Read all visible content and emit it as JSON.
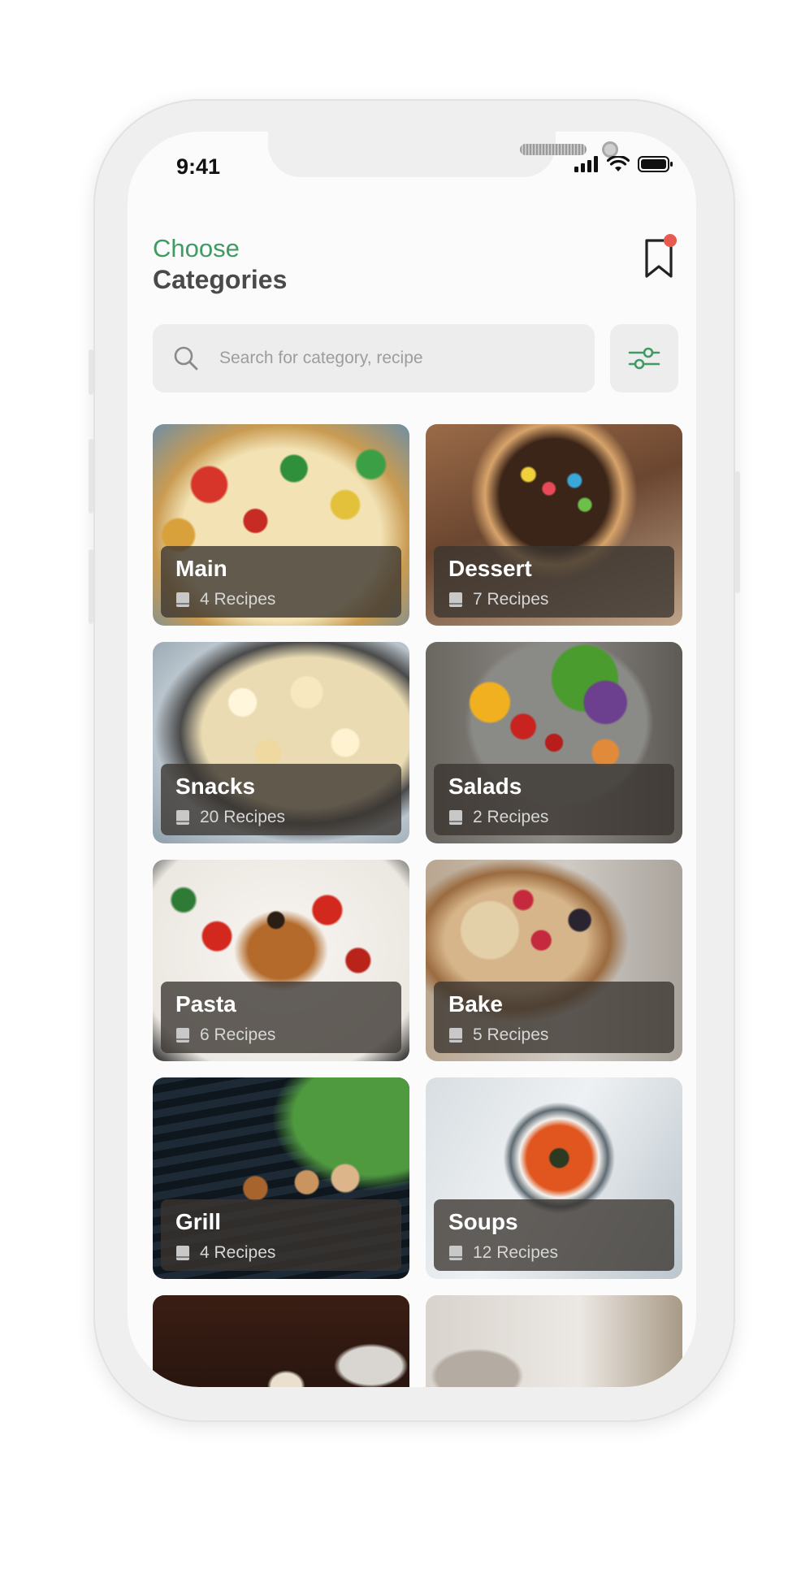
{
  "status_bar": {
    "time": "9:41"
  },
  "header": {
    "subtitle": "Choose",
    "title": "Categories"
  },
  "search": {
    "placeholder": "Search for category, recipe"
  },
  "categories": [
    {
      "name": "Main",
      "count": "4 Recipes"
    },
    {
      "name": "Dessert",
      "count": "7 Recipes"
    },
    {
      "name": "Snacks",
      "count": "20 Recipes"
    },
    {
      "name": "Salads",
      "count": "2 Recipes"
    },
    {
      "name": "Pasta",
      "count": "6 Recipes"
    },
    {
      "name": "Bake",
      "count": "5 Recipes"
    },
    {
      "name": "Grill",
      "count": "4 Recipes"
    },
    {
      "name": "Soups",
      "count": "12 Recipes"
    }
  ],
  "colors": {
    "accent": "#3f9a63",
    "notification": "#e8594e",
    "title": "#4a4a4a"
  }
}
